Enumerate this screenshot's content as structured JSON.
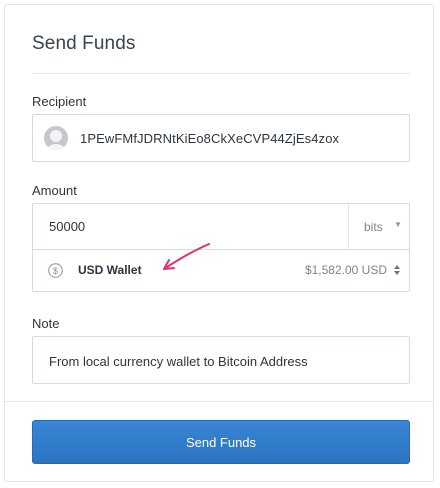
{
  "form": {
    "title": "Send Funds",
    "recipient": {
      "label": "Recipient",
      "value": "1PEwFMfJDRNtKiEo8CkXeCVP44ZjEs4zox",
      "avatar_icon": "user-avatar-icon"
    },
    "amount": {
      "label": "Amount",
      "value": "50000",
      "unit": "bits",
      "unit_icon": "chevron-down-icon"
    },
    "wallet": {
      "icon": "dollar-coin-icon",
      "name": "USD Wallet",
      "balance": "$1,582.00 USD",
      "caret_icon": "up-down-caret-icon"
    },
    "note": {
      "label": "Note",
      "value": "From local currency wallet to Bitcoin Address"
    },
    "submit_label": "Send Funds"
  },
  "annotation": {
    "icon": "arrow-annotation-icon",
    "color": "#e0316f"
  },
  "colors": {
    "button": "#2f7bc8",
    "border": "#d7dbe0"
  }
}
